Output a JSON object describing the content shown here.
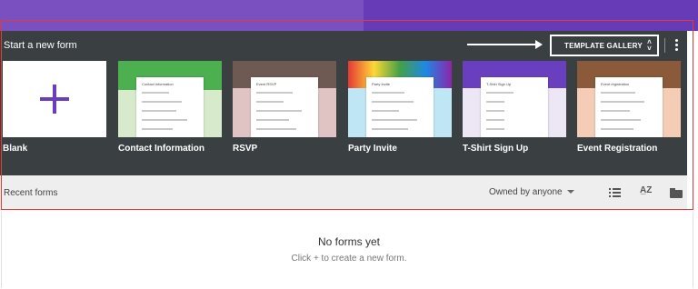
{
  "header": {
    "title": "Start a new form",
    "gallery_button": "TEMPLATE GALLERY",
    "gallery_icon": "unfold-more-icon",
    "more_icon": "more-vert-icon"
  },
  "templates": [
    {
      "label": "Blank",
      "accent": "#6a3fbf"
    },
    {
      "label": "Contact Information",
      "accent": "#4caf50",
      "card_title": "Contact information"
    },
    {
      "label": "RSVP",
      "accent": "#e0c4c4",
      "card_title": "Event RSVP"
    },
    {
      "label": "Party Invite",
      "accent": "#bfe6f5",
      "card_title": "Party Invite"
    },
    {
      "label": "T-Shirt Sign Up",
      "accent": "#6a3fbf",
      "card_title": "T-Shirt Sign Up"
    },
    {
      "label": "Event Registration",
      "accent": "#f5cdb7",
      "card_title": "Event registration"
    }
  ],
  "recent": {
    "label": "Recent forms",
    "owner_filter": "Owned by anyone",
    "icons": [
      "list-view-icon",
      "sort-az-icon",
      "folder-icon"
    ]
  },
  "empty_state": {
    "title": "No forms yet",
    "hint": "Click + to create a new form."
  },
  "colors": {
    "panel": "#3a4042",
    "brand_purple": "#673ab7",
    "highlight_frame": "#e53935"
  }
}
